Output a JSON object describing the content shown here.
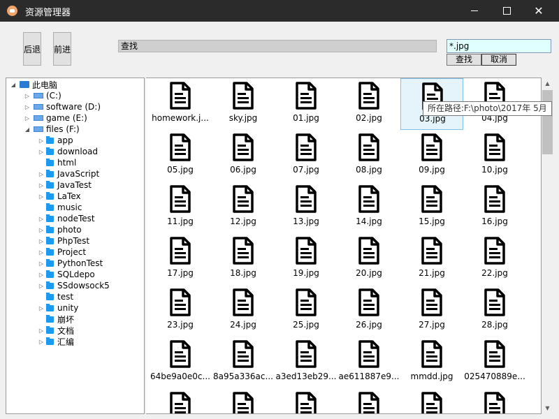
{
  "window": {
    "title": "资源管理器"
  },
  "toolbar": {
    "back_label": "后退",
    "forward_label": "前进"
  },
  "path": {
    "value": "查找"
  },
  "search": {
    "value": "*.jpg",
    "find_label": "查找",
    "cancel_label": "取消"
  },
  "tree": [
    {
      "label": "此电脑",
      "type": "pc",
      "expanded": true
    },
    {
      "label": " (C:)",
      "type": "drive",
      "expanded": false
    },
    {
      "label": "software (D:)",
      "type": "drive",
      "expanded": false
    },
    {
      "label": "game (E:)",
      "type": "drive",
      "expanded": false
    },
    {
      "label": "files (F:)",
      "type": "drive",
      "expanded": true
    },
    {
      "label": "app",
      "type": "folder",
      "has_children": true
    },
    {
      "label": "download",
      "type": "folder",
      "has_children": true
    },
    {
      "label": "html",
      "type": "folder",
      "has_children": false
    },
    {
      "label": "JavaScript",
      "type": "folder",
      "has_children": true
    },
    {
      "label": "JavaTest",
      "type": "folder",
      "has_children": true
    },
    {
      "label": "LaTex",
      "type": "folder",
      "has_children": true
    },
    {
      "label": "music",
      "type": "folder",
      "has_children": false
    },
    {
      "label": "nodeTest",
      "type": "folder",
      "has_children": true
    },
    {
      "label": "photo",
      "type": "folder",
      "has_children": true
    },
    {
      "label": "PhpTest",
      "type": "folder",
      "has_children": true
    },
    {
      "label": "Project",
      "type": "folder",
      "has_children": true
    },
    {
      "label": "PythonTest",
      "type": "folder",
      "has_children": true
    },
    {
      "label": "SQLdepo",
      "type": "folder",
      "has_children": true
    },
    {
      "label": "SSdowsock5",
      "type": "folder",
      "has_children": true
    },
    {
      "label": "test",
      "type": "folder",
      "has_children": false
    },
    {
      "label": "unity",
      "type": "folder",
      "has_children": true
    },
    {
      "label": "崩坏",
      "type": "folder",
      "has_children": false
    },
    {
      "label": "文档",
      "type": "folder",
      "has_children": true
    },
    {
      "label": "汇编",
      "type": "folder",
      "has_children": true
    }
  ],
  "files": [
    "homework.j...",
    "sky.jpg",
    "01.jpg",
    "02.jpg",
    "03.jpg",
    "04.jpg",
    "05.jpg",
    "06.jpg",
    "07.jpg",
    "08.jpg",
    "09.jpg",
    "10.jpg",
    "11.jpg",
    "12.jpg",
    "13.jpg",
    "14.jpg",
    "15.jpg",
    "16.jpg",
    "17.jpg",
    "18.jpg",
    "19.jpg",
    "20.jpg",
    "21.jpg",
    "22.jpg",
    "23.jpg",
    "24.jpg",
    "25.jpg",
    "26.jpg",
    "27.jpg",
    "28.jpg",
    "64be9a0e0c...",
    "8a95a336ac...",
    "a3ed13eb29...",
    "ae611887e9...",
    "mmdd.jpg",
    "025470889e...",
    "",
    "",
    "",
    "",
    "",
    ""
  ],
  "selected_file": "03.jpg",
  "tooltip": "所在路径:F:\\photo\\2017年 5月",
  "icons": {
    "app": "app-logo-icon",
    "file": "document-icon",
    "drive": "drive-icon",
    "folder": "folder-icon",
    "pc": "computer-icon"
  }
}
